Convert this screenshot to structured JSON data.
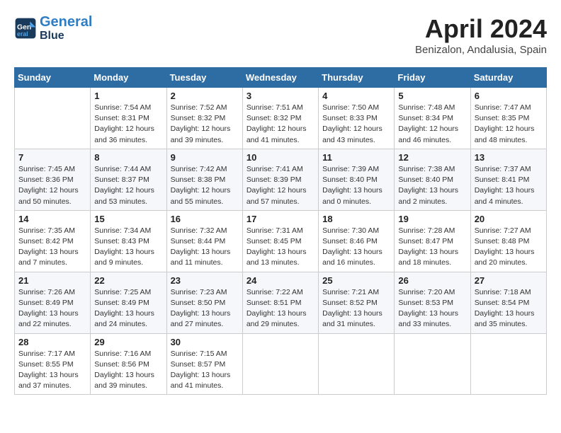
{
  "header": {
    "logo_line1": "General",
    "logo_line2": "Blue",
    "month_title": "April 2024",
    "location": "Benizalon, Andalusia, Spain"
  },
  "days_of_week": [
    "Sunday",
    "Monday",
    "Tuesday",
    "Wednesday",
    "Thursday",
    "Friday",
    "Saturday"
  ],
  "weeks": [
    [
      {
        "day": "",
        "sunrise": "",
        "sunset": "",
        "daylight": ""
      },
      {
        "day": "1",
        "sunrise": "Sunrise: 7:54 AM",
        "sunset": "Sunset: 8:31 PM",
        "daylight": "Daylight: 12 hours and 36 minutes."
      },
      {
        "day": "2",
        "sunrise": "Sunrise: 7:52 AM",
        "sunset": "Sunset: 8:32 PM",
        "daylight": "Daylight: 12 hours and 39 minutes."
      },
      {
        "day": "3",
        "sunrise": "Sunrise: 7:51 AM",
        "sunset": "Sunset: 8:32 PM",
        "daylight": "Daylight: 12 hours and 41 minutes."
      },
      {
        "day": "4",
        "sunrise": "Sunrise: 7:50 AM",
        "sunset": "Sunset: 8:33 PM",
        "daylight": "Daylight: 12 hours and 43 minutes."
      },
      {
        "day": "5",
        "sunrise": "Sunrise: 7:48 AM",
        "sunset": "Sunset: 8:34 PM",
        "daylight": "Daylight: 12 hours and 46 minutes."
      },
      {
        "day": "6",
        "sunrise": "Sunrise: 7:47 AM",
        "sunset": "Sunset: 8:35 PM",
        "daylight": "Daylight: 12 hours and 48 minutes."
      }
    ],
    [
      {
        "day": "7",
        "sunrise": "Sunrise: 7:45 AM",
        "sunset": "Sunset: 8:36 PM",
        "daylight": "Daylight: 12 hours and 50 minutes."
      },
      {
        "day": "8",
        "sunrise": "Sunrise: 7:44 AM",
        "sunset": "Sunset: 8:37 PM",
        "daylight": "Daylight: 12 hours and 53 minutes."
      },
      {
        "day": "9",
        "sunrise": "Sunrise: 7:42 AM",
        "sunset": "Sunset: 8:38 PM",
        "daylight": "Daylight: 12 hours and 55 minutes."
      },
      {
        "day": "10",
        "sunrise": "Sunrise: 7:41 AM",
        "sunset": "Sunset: 8:39 PM",
        "daylight": "Daylight: 12 hours and 57 minutes."
      },
      {
        "day": "11",
        "sunrise": "Sunrise: 7:39 AM",
        "sunset": "Sunset: 8:40 PM",
        "daylight": "Daylight: 13 hours and 0 minutes."
      },
      {
        "day": "12",
        "sunrise": "Sunrise: 7:38 AM",
        "sunset": "Sunset: 8:40 PM",
        "daylight": "Daylight: 13 hours and 2 minutes."
      },
      {
        "day": "13",
        "sunrise": "Sunrise: 7:37 AM",
        "sunset": "Sunset: 8:41 PM",
        "daylight": "Daylight: 13 hours and 4 minutes."
      }
    ],
    [
      {
        "day": "14",
        "sunrise": "Sunrise: 7:35 AM",
        "sunset": "Sunset: 8:42 PM",
        "daylight": "Daylight: 13 hours and 7 minutes."
      },
      {
        "day": "15",
        "sunrise": "Sunrise: 7:34 AM",
        "sunset": "Sunset: 8:43 PM",
        "daylight": "Daylight: 13 hours and 9 minutes."
      },
      {
        "day": "16",
        "sunrise": "Sunrise: 7:32 AM",
        "sunset": "Sunset: 8:44 PM",
        "daylight": "Daylight: 13 hours and 11 minutes."
      },
      {
        "day": "17",
        "sunrise": "Sunrise: 7:31 AM",
        "sunset": "Sunset: 8:45 PM",
        "daylight": "Daylight: 13 hours and 13 minutes."
      },
      {
        "day": "18",
        "sunrise": "Sunrise: 7:30 AM",
        "sunset": "Sunset: 8:46 PM",
        "daylight": "Daylight: 13 hours and 16 minutes."
      },
      {
        "day": "19",
        "sunrise": "Sunrise: 7:28 AM",
        "sunset": "Sunset: 8:47 PM",
        "daylight": "Daylight: 13 hours and 18 minutes."
      },
      {
        "day": "20",
        "sunrise": "Sunrise: 7:27 AM",
        "sunset": "Sunset: 8:48 PM",
        "daylight": "Daylight: 13 hours and 20 minutes."
      }
    ],
    [
      {
        "day": "21",
        "sunrise": "Sunrise: 7:26 AM",
        "sunset": "Sunset: 8:49 PM",
        "daylight": "Daylight: 13 hours and 22 minutes."
      },
      {
        "day": "22",
        "sunrise": "Sunrise: 7:25 AM",
        "sunset": "Sunset: 8:49 PM",
        "daylight": "Daylight: 13 hours and 24 minutes."
      },
      {
        "day": "23",
        "sunrise": "Sunrise: 7:23 AM",
        "sunset": "Sunset: 8:50 PM",
        "daylight": "Daylight: 13 hours and 27 minutes."
      },
      {
        "day": "24",
        "sunrise": "Sunrise: 7:22 AM",
        "sunset": "Sunset: 8:51 PM",
        "daylight": "Daylight: 13 hours and 29 minutes."
      },
      {
        "day": "25",
        "sunrise": "Sunrise: 7:21 AM",
        "sunset": "Sunset: 8:52 PM",
        "daylight": "Daylight: 13 hours and 31 minutes."
      },
      {
        "day": "26",
        "sunrise": "Sunrise: 7:20 AM",
        "sunset": "Sunset: 8:53 PM",
        "daylight": "Daylight: 13 hours and 33 minutes."
      },
      {
        "day": "27",
        "sunrise": "Sunrise: 7:18 AM",
        "sunset": "Sunset: 8:54 PM",
        "daylight": "Daylight: 13 hours and 35 minutes."
      }
    ],
    [
      {
        "day": "28",
        "sunrise": "Sunrise: 7:17 AM",
        "sunset": "Sunset: 8:55 PM",
        "daylight": "Daylight: 13 hours and 37 minutes."
      },
      {
        "day": "29",
        "sunrise": "Sunrise: 7:16 AM",
        "sunset": "Sunset: 8:56 PM",
        "daylight": "Daylight: 13 hours and 39 minutes."
      },
      {
        "day": "30",
        "sunrise": "Sunrise: 7:15 AM",
        "sunset": "Sunset: 8:57 PM",
        "daylight": "Daylight: 13 hours and 41 minutes."
      },
      {
        "day": "",
        "sunrise": "",
        "sunset": "",
        "daylight": ""
      },
      {
        "day": "",
        "sunrise": "",
        "sunset": "",
        "daylight": ""
      },
      {
        "day": "",
        "sunrise": "",
        "sunset": "",
        "daylight": ""
      },
      {
        "day": "",
        "sunrise": "",
        "sunset": "",
        "daylight": ""
      }
    ]
  ]
}
